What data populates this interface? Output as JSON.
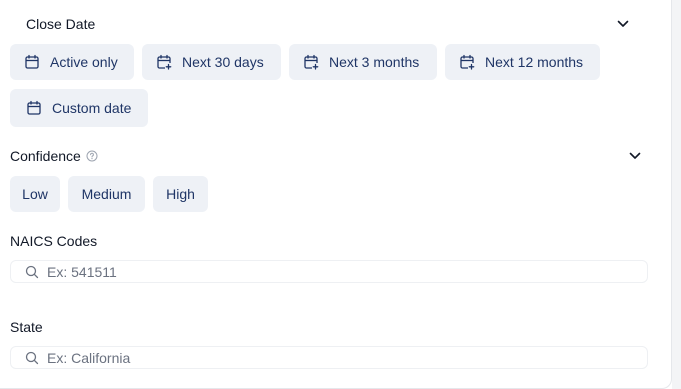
{
  "close_date": {
    "title": "Close Date",
    "chips": [
      {
        "label": "Active only",
        "icon": "calendar-icon"
      },
      {
        "label": "Next 30 days",
        "icon": "calendar-plus-icon"
      },
      {
        "label": "Next 3 months",
        "icon": "calendar-plus-icon"
      },
      {
        "label": "Next 12 months",
        "icon": "calendar-plus-icon"
      },
      {
        "label": "Custom date",
        "icon": "calendar-icon"
      }
    ]
  },
  "confidence": {
    "title": "Confidence",
    "chips": [
      {
        "label": "Low"
      },
      {
        "label": "Medium"
      },
      {
        "label": "High"
      }
    ]
  },
  "naics": {
    "title": "NAICS Codes",
    "placeholder": "Ex: 541511",
    "value": ""
  },
  "state": {
    "title": "State",
    "placeholder": "Ex: California",
    "value": ""
  },
  "colors": {
    "chip_bg": "#eef1f6",
    "chip_text": "#1f3566"
  }
}
